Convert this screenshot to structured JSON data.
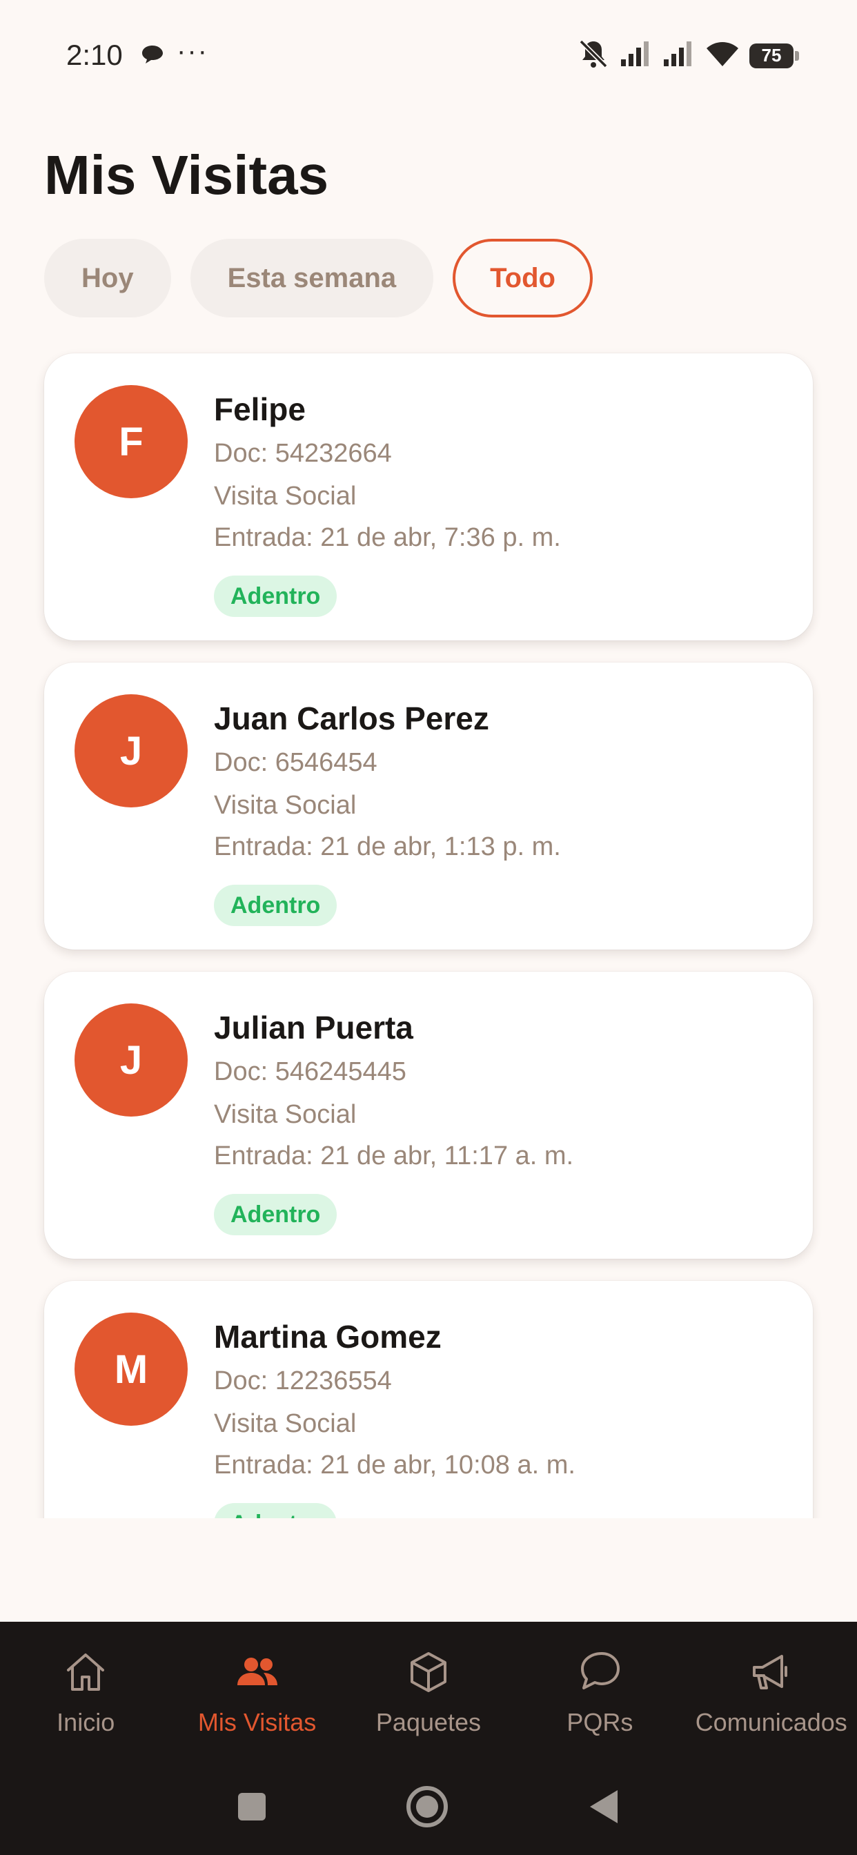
{
  "status_bar": {
    "time": "2:10",
    "more_indicator": "···",
    "battery": "75",
    "icons": [
      "chat-bubble-icon",
      "bell-off-icon",
      "signal-icon",
      "signal-icon",
      "wifi-icon",
      "battery-icon"
    ]
  },
  "page": {
    "title": "Mis Visitas"
  },
  "filters": {
    "today": "Hoy",
    "week": "Esta semana",
    "all": "Todo",
    "selected": "Todo"
  },
  "visits": [
    {
      "initial": "F",
      "name": "Felipe",
      "doc": "Doc: 54232664",
      "type": "Visita Social",
      "entry": "Entrada: 21 de abr, 7:36 p. m.",
      "status": "Adentro"
    },
    {
      "initial": "J",
      "name": "Juan Carlos Perez",
      "doc": "Doc: 6546454",
      "type": "Visita Social",
      "entry": "Entrada: 21 de abr, 1:13 p. m.",
      "status": "Adentro"
    },
    {
      "initial": "J",
      "name": "Julian Puerta",
      "doc": "Doc: 546245445",
      "type": "Visita Social",
      "entry": "Entrada: 21 de abr, 11:17 a. m.",
      "status": "Adentro"
    },
    {
      "initial": "M",
      "name": "Martina Gomez",
      "doc": "Doc: 12236554",
      "type": "Visita Social",
      "entry": "Entrada: 21 de abr, 10:08 a. m.",
      "status": "Adentro"
    }
  ],
  "bottom_nav": {
    "items": [
      {
        "label": "Inicio",
        "icon": "home-icon"
      },
      {
        "label": "Mis Visitas",
        "icon": "people-icon"
      },
      {
        "label": "Paquetes",
        "icon": "package-icon"
      },
      {
        "label": "PQRs",
        "icon": "chat-icon"
      },
      {
        "label": "Comunicados",
        "icon": "megaphone-icon"
      }
    ],
    "active": "Mis Visitas"
  },
  "colors": {
    "accent": "#e2572f",
    "background": "#fdf8f5",
    "status_green": "#22b35a",
    "nav_background": "#1a1615"
  }
}
